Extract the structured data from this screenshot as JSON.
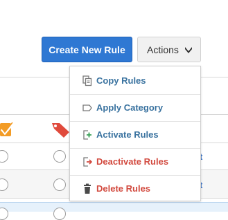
{
  "toolbar": {
    "create_label": "Create New Rule",
    "actions_label": "Actions",
    "primary_color": "#2f78d3"
  },
  "menu": {
    "items": [
      {
        "label": "Copy Rules",
        "icon": "copy-icon",
        "tone": "normal"
      },
      {
        "label": "Apply Category",
        "icon": "tag-outline-icon",
        "tone": "normal"
      },
      {
        "label": "Activate Rules",
        "icon": "activate-icon",
        "tone": "normal"
      },
      {
        "label": "Deactivate Rules",
        "icon": "deactivate-icon",
        "tone": "danger"
      },
      {
        "label": "Delete Rules",
        "icon": "trash-icon",
        "tone": "danger"
      }
    ]
  },
  "table": {
    "header_icons": [
      "checkbox-icon",
      "tag-icon"
    ],
    "rows": [
      {
        "link": "t"
      },
      {
        "link": "t"
      }
    ]
  },
  "colors": {
    "link": "#39729f",
    "danger": "#d24a3f",
    "checkbox": "#f39c26",
    "tag": "#e04a3c"
  }
}
